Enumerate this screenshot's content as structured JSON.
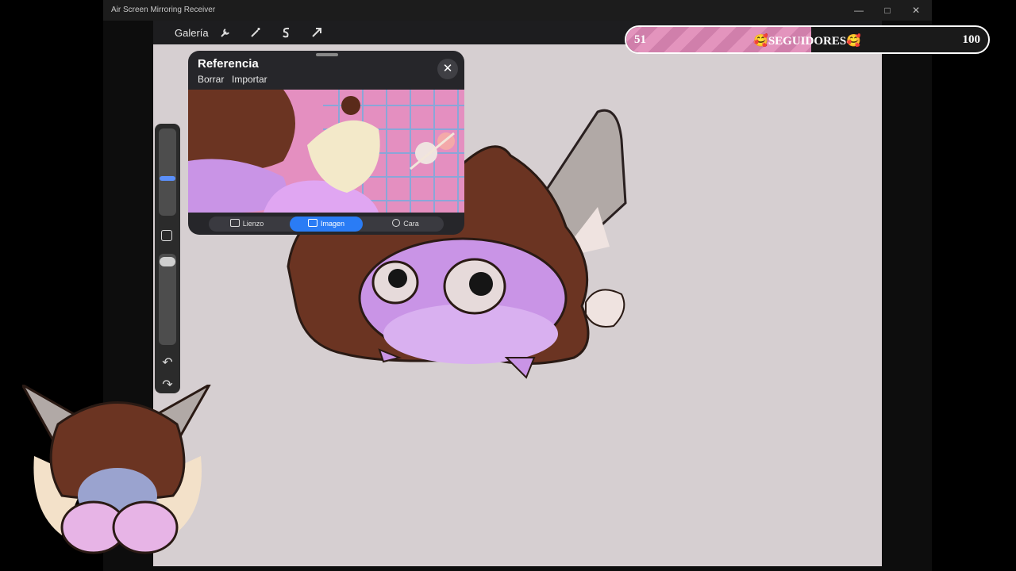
{
  "window": {
    "title": "Air Screen Mirroring Receiver",
    "controls": [
      "minimize-icon",
      "maximize-icon",
      "close-icon"
    ]
  },
  "procreate": {
    "gallery_label": "Galería",
    "tools": [
      "wrench-icon",
      "magic-wand-icon",
      "selection-icon",
      "transform-arrow-icon"
    ]
  },
  "followers_goal": {
    "current": "51",
    "label": "🥰SEGUIDORES🥰",
    "target": "100",
    "progress": 0.51,
    "colors": {
      "fill": "#e394bd",
      "border": "#ffffff"
    }
  },
  "reference_panel": {
    "title": "Referencia",
    "actions": [
      "Borrar",
      "Importar"
    ],
    "tabs": [
      {
        "label": "Lienzo",
        "icon": "canvas-icon",
        "active": false
      },
      {
        "label": "Imagen",
        "icon": "image-icon",
        "active": true
      },
      {
        "label": "Cara",
        "icon": "face-icon",
        "active": false
      }
    ],
    "accent": "#2a7cf5"
  },
  "sidebar": {
    "icons": [
      "brush-size-slider",
      "modify-square-icon",
      "opacity-slider",
      "undo-icon",
      "redo-icon"
    ]
  }
}
